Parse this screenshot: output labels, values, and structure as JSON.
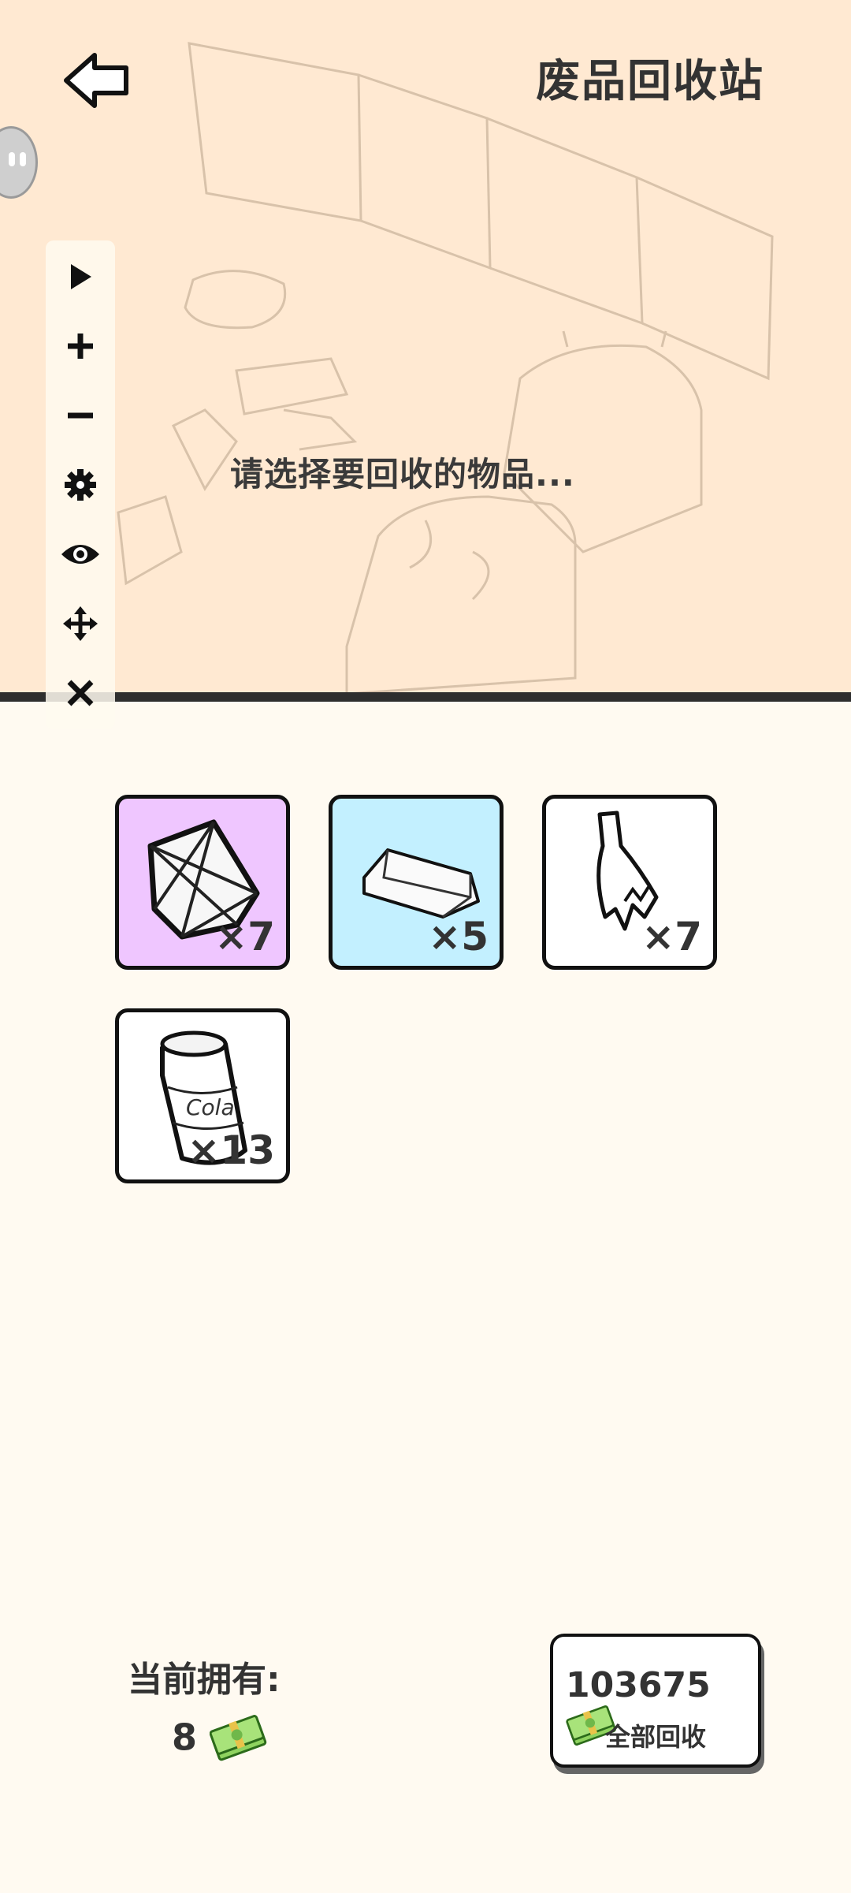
{
  "header": {
    "title": "废品回收站"
  },
  "status": {
    "prompt": "请选择要回收的物品..."
  },
  "toolbar": {
    "items": [
      {
        "icon": "play-icon"
      },
      {
        "icon": "plus-icon"
      },
      {
        "icon": "minus-icon"
      },
      {
        "icon": "gear-icon"
      },
      {
        "icon": "eye-icon"
      },
      {
        "icon": "move-icon"
      },
      {
        "icon": "close-icon"
      }
    ]
  },
  "inventory": {
    "items": [
      {
        "name": "diamond",
        "count": "×7",
        "bg": "#efc6ff"
      },
      {
        "name": "silver-bar",
        "count": "×5",
        "bg": "#c3f0ff"
      },
      {
        "name": "broken-bottle",
        "count": "×7",
        "bg": "#ffffff"
      },
      {
        "name": "cola-can",
        "count": "×13",
        "bg": "#ffffff"
      }
    ]
  },
  "wallet": {
    "label": "当前拥有:",
    "amount": "8"
  },
  "recycle_all": {
    "amount": "103675",
    "label": "全部回收"
  },
  "colors": {
    "top_bg": "#ffe9d2",
    "page_bg": "#fffaf1",
    "purple": "#efc6ff",
    "blue": "#c3f0ff"
  }
}
